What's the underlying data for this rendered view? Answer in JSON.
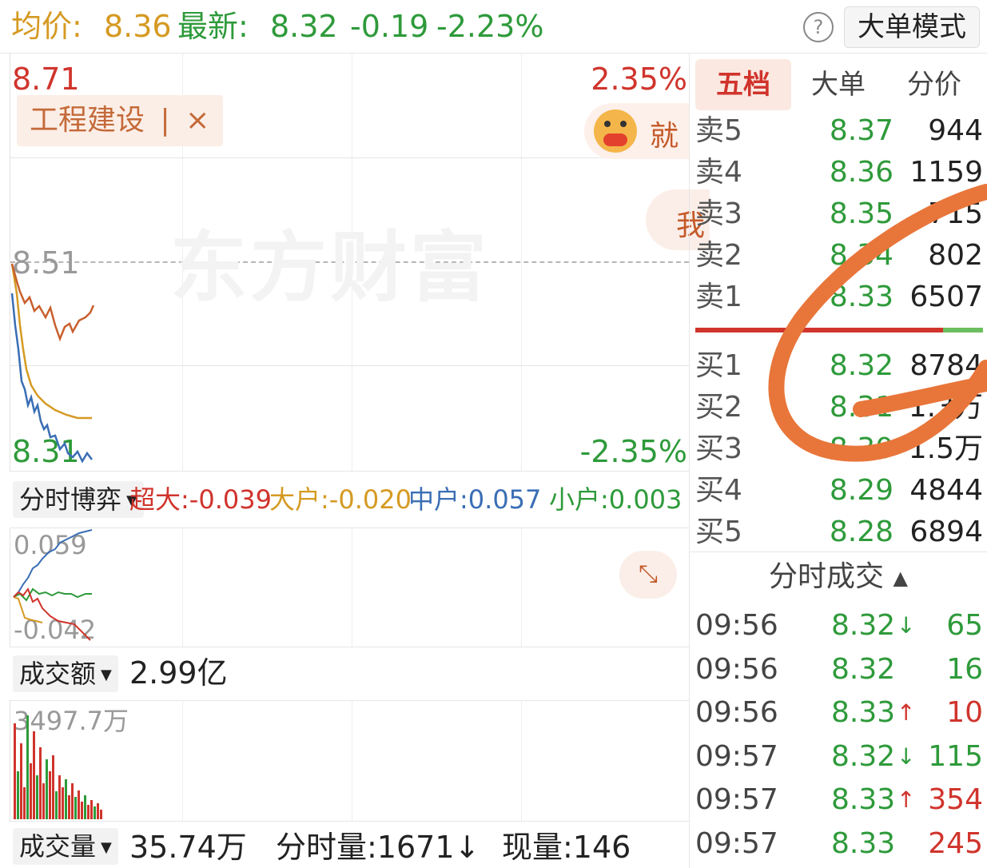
{
  "header": {
    "avg_label": "均价:",
    "avg_value": "8.36",
    "latest_label": "最新:",
    "latest_value": "8.32",
    "change": "-0.19",
    "change_pct": "-2.23%",
    "help_icon": "question-circle-icon",
    "mode_button": "大单模式"
  },
  "price_chart": {
    "high_price": "8.71",
    "high_pct": "2.35%",
    "ref_price": "8.51",
    "low_price": "8.31",
    "low_pct": "-2.35%",
    "sector_tag": "工程建设",
    "sector_tag_sep": "|",
    "close_icon": "×",
    "promo_text": "就",
    "promo_icon": "mascot-cow-icon",
    "side_button_text": "我",
    "watermark": "东方财富"
  },
  "game_panel": {
    "dropdown": "分时博弈",
    "caret": "▼",
    "super_large": "超大:-0.039",
    "large": "大户:-0.020",
    "medium": "中户:0.057",
    "small": "小户:0.003",
    "max": "0.059",
    "min": "-0.042",
    "expand_icon": "expand-arrows-icon"
  },
  "turnover_panel": {
    "dropdown": "成交额",
    "caret": "▼",
    "total": "2.99亿",
    "max_label": "3497.7万"
  },
  "volume_footer": {
    "dropdown": "成交量",
    "caret": "▼",
    "total": "35.74万",
    "minute_volume": "分时量:1671↓",
    "current_volume": "现量:146"
  },
  "order_book": {
    "tabs": [
      "五档",
      "大单",
      "分价"
    ],
    "active_tab": 0,
    "asks": [
      {
        "label": "卖5",
        "price": "8.37",
        "vol": "944"
      },
      {
        "label": "卖4",
        "price": "8.36",
        "vol": "1159"
      },
      {
        "label": "卖3",
        "price": "8.35",
        "vol": "715"
      },
      {
        "label": "卖2",
        "price": "8.34",
        "vol": "802"
      },
      {
        "label": "卖1",
        "price": "8.33",
        "vol": "6507"
      }
    ],
    "bids": [
      {
        "label": "买1",
        "price": "8.32",
        "vol": "8784"
      },
      {
        "label": "买2",
        "price": "8.31",
        "vol": "1.3万"
      },
      {
        "label": "买3",
        "price": "8.30",
        "vol": "1.5万"
      },
      {
        "label": "买4",
        "price": "8.29",
        "vol": "4844"
      },
      {
        "label": "买5",
        "price": "8.28",
        "vol": "6894"
      }
    ],
    "ratio_sell_fraction": 0.86
  },
  "trades": {
    "title": "分时成交",
    "title_arrow": "▲",
    "rows": [
      {
        "time": "09:56",
        "price": "8.32",
        "dir": "↓",
        "vol": "65",
        "vol_color": "green"
      },
      {
        "time": "09:56",
        "price": "8.32",
        "dir": "",
        "vol": "16",
        "vol_color": "green"
      },
      {
        "time": "09:56",
        "price": "8.33",
        "dir": "↑",
        "vol": "10",
        "vol_color": "red"
      },
      {
        "time": "09:57",
        "price": "8.32",
        "dir": "↓",
        "vol": "115",
        "vol_color": "green"
      },
      {
        "time": "09:57",
        "price": "8.33",
        "dir": "↑",
        "vol": "354",
        "vol_color": "red"
      },
      {
        "time": "09:57",
        "price": "8.33",
        "dir": "",
        "vol": "245",
        "vol_color": "red"
      }
    ]
  },
  "colors": {
    "up": "#d0342c",
    "down": "#2e9a3a",
    "avg_line": "#d59a22",
    "price_line": "#3a6eb5",
    "annotation": "#e8763a"
  }
}
